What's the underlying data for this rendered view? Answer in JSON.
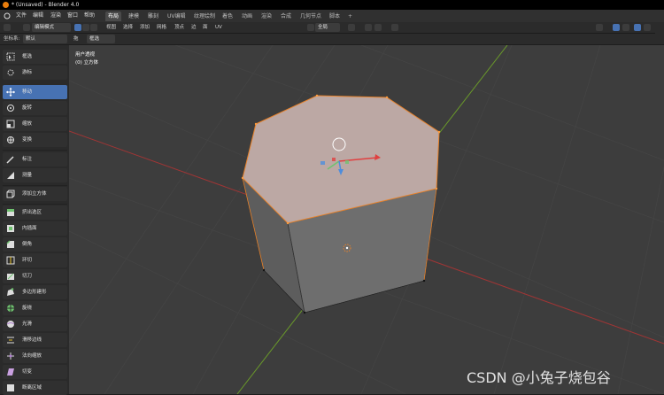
{
  "window": {
    "title": "* (Unsaved) - Blender 4.0"
  },
  "menu": [
    "文件",
    "编辑",
    "渲染",
    "窗口",
    "帮助"
  ],
  "workspaces": [
    "布局",
    "建模",
    "雕刻",
    "UV编辑",
    "纹理绘制",
    "着色",
    "动画",
    "渲染",
    "合成",
    "几何节点",
    "脚本"
  ],
  "active_workspace": "布局",
  "header": {
    "mode": "编辑模式",
    "view_menus": [
      "视图",
      "选择",
      "添加",
      "网格",
      "顶点",
      "边",
      "面",
      "UV"
    ],
    "orientation": "全局"
  },
  "tool_settings": {
    "coord_label": "坐标系:",
    "coord_value": "默认",
    "drag_label": "拖",
    "select_value": "框选"
  },
  "tools": [
    {
      "label": "框选",
      "icon": "select-box-icon",
      "active": false
    },
    {
      "label": "游标",
      "icon": "cursor-icon",
      "active": false
    },
    {
      "label": "移动",
      "icon": "move-icon",
      "active": true
    },
    {
      "label": "旋转",
      "icon": "rotate-icon",
      "active": false
    },
    {
      "label": "缩放",
      "icon": "scale-icon",
      "active": false
    },
    {
      "label": "变换",
      "icon": "transform-icon",
      "active": false
    },
    {
      "label": "标注",
      "icon": "annotate-icon",
      "active": false
    },
    {
      "label": "测量",
      "icon": "measure-icon",
      "active": false
    },
    {
      "label": "添加立方体",
      "icon": "add-cube-icon",
      "active": false
    },
    {
      "label": "挤出选区",
      "icon": "extrude-icon",
      "active": false
    },
    {
      "label": "内插面",
      "icon": "inset-icon",
      "active": false
    },
    {
      "label": "倒角",
      "icon": "bevel-icon",
      "active": false
    },
    {
      "label": "环切",
      "icon": "loopcut-icon",
      "active": false
    },
    {
      "label": "切刀",
      "icon": "knife-icon",
      "active": false
    },
    {
      "label": "多边形建形",
      "icon": "polybuild-icon",
      "active": false
    },
    {
      "label": "旋绕",
      "icon": "spin-icon",
      "active": false
    },
    {
      "label": "光滑",
      "icon": "smooth-icon",
      "active": false
    },
    {
      "label": "滑移边线",
      "icon": "edge-slide-icon",
      "active": false
    },
    {
      "label": "法向缩放",
      "icon": "shrink-fatten-icon",
      "active": false
    },
    {
      "label": "切变",
      "icon": "shear-icon",
      "active": false
    },
    {
      "label": "断离区域",
      "icon": "rip-icon",
      "active": false
    }
  ],
  "viewport": {
    "view_name": "用户透视",
    "object_name": "(0) 立方体"
  },
  "watermark": "CSDN @小兔子烧包谷",
  "colors": {
    "accent": "#4772b3",
    "selected_edge": "#e8822a",
    "x_axis": "#b03434",
    "y_axis": "#6a9a2a"
  }
}
